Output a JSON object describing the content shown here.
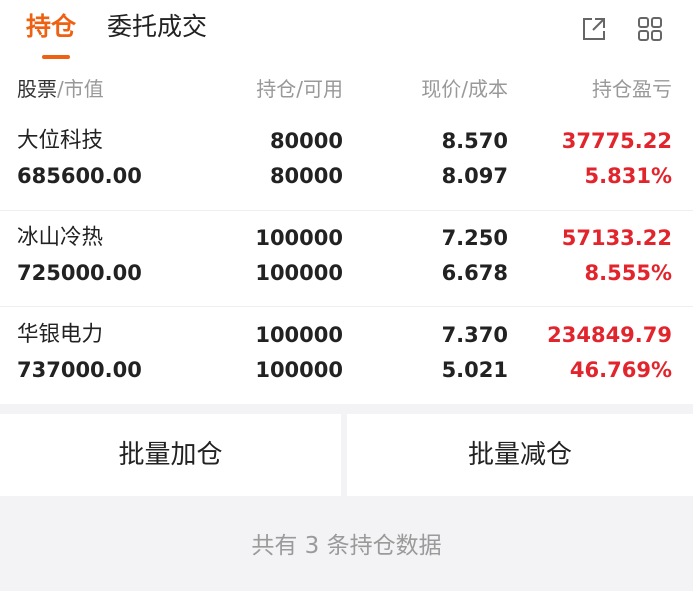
{
  "tabs": {
    "active": "持仓",
    "inactive": "委托成交"
  },
  "colors": {
    "accent": "#ee6112",
    "profit": "#e2242c"
  },
  "icons": {
    "share": "share-icon",
    "grid": "grid-icon"
  },
  "header": {
    "stock": "股票",
    "market_value": "/市值",
    "position": "持仓/可用",
    "price": "现价/成本",
    "pnl": "持仓盈亏"
  },
  "rows": [
    {
      "name": "大位科技",
      "market_value": "685600.00",
      "position": "80000",
      "available": "80000",
      "price": "8.570",
      "cost": "8.097",
      "pnl": "37775.22",
      "pnl_pct": "5.831%"
    },
    {
      "name": "冰山冷热",
      "market_value": "725000.00",
      "position": "100000",
      "available": "100000",
      "price": "7.250",
      "cost": "6.678",
      "pnl": "57133.22",
      "pnl_pct": "8.555%"
    },
    {
      "name": "华银电力",
      "market_value": "737000.00",
      "position": "100000",
      "available": "100000",
      "price": "7.370",
      "cost": "5.021",
      "pnl": "234849.79",
      "pnl_pct": "46.769%"
    }
  ],
  "buttons": {
    "batch_add": "批量加仓",
    "batch_reduce": "批量减仓"
  },
  "footer": "共有 3 条持仓数据"
}
